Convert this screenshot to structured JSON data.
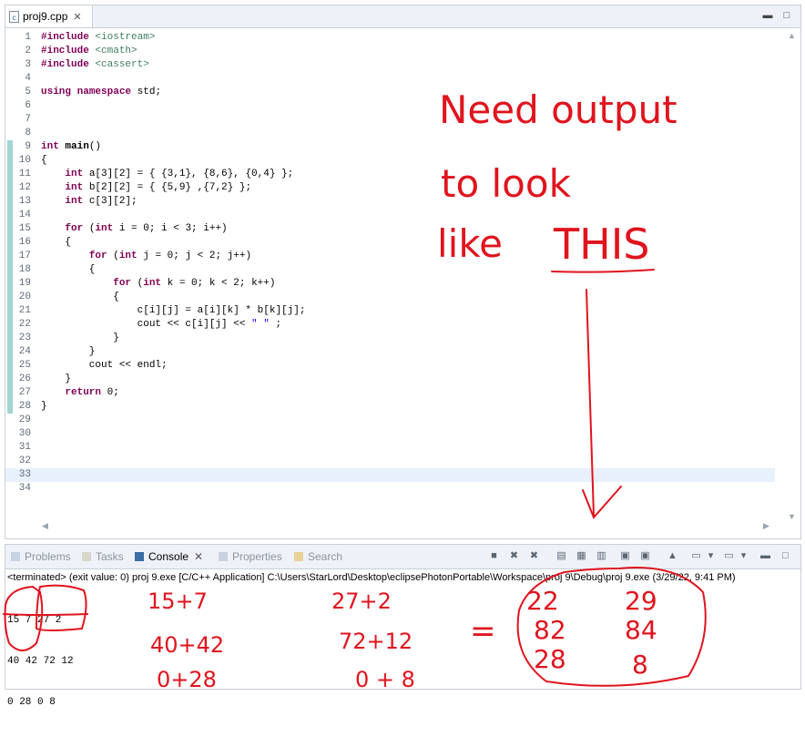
{
  "editor": {
    "tab_label": "proj9.cpp",
    "tab_icon": "c-file-icon",
    "lines": [
      {
        "n": "1",
        "html": "<span class='kw'>#include</span> <span class='inc'>&lt;iostream&gt;</span>"
      },
      {
        "n": "2",
        "html": "<span class='kw'>#include</span> <span class='inc'>&lt;cmath&gt;</span>"
      },
      {
        "n": "3",
        "html": "<span class='kw'>#include</span> <span class='inc'>&lt;cassert&gt;</span>"
      },
      {
        "n": "4",
        "html": ""
      },
      {
        "n": "5",
        "html": "<span class='kw'>using</span> <span class='kw'>namespace</span> std;"
      },
      {
        "n": "6",
        "html": ""
      },
      {
        "n": "7",
        "html": ""
      },
      {
        "n": "8",
        "html": ""
      },
      {
        "n": "9",
        "html": "<span class='kw'>int</span> <b>main</b>()"
      },
      {
        "n": "10",
        "html": "{"
      },
      {
        "n": "11",
        "html": "    <span class='kw'>int</span> a[3][2] = { {3,1}, {8,6}, {0,4} };"
      },
      {
        "n": "12",
        "html": "    <span class='kw'>int</span> b[2][2] = { {5,9} ,{7,2} };"
      },
      {
        "n": "13",
        "html": "    <span class='kw'>int</span> c[3][2];"
      },
      {
        "n": "14",
        "html": ""
      },
      {
        "n": "15",
        "html": "    <span class='kw'>for</span> (<span class='kw'>int</span> i = 0; i &lt; 3; i++)"
      },
      {
        "n": "16",
        "html": "    {"
      },
      {
        "n": "17",
        "html": "        <span class='kw'>for</span> (<span class='kw'>int</span> j = 0; j &lt; 2; j++)"
      },
      {
        "n": "18",
        "html": "        {"
      },
      {
        "n": "19",
        "html": "            <span class='kw'>for</span> (<span class='kw'>int</span> k = 0; k &lt; 2; k++)"
      },
      {
        "n": "20",
        "html": "            {"
      },
      {
        "n": "21",
        "html": "                c[i][j] = a[i][k] * b[k][j];"
      },
      {
        "n": "22",
        "html": "                cout &lt;&lt; c[i][j] &lt;&lt; <span class='str'>\" \"</span> ;"
      },
      {
        "n": "23",
        "html": "            }"
      },
      {
        "n": "24",
        "html": "        }"
      },
      {
        "n": "25",
        "html": "        cout &lt;&lt; endl;"
      },
      {
        "n": "26",
        "html": "    }"
      },
      {
        "n": "27",
        "html": "    <span class='kw'>return</span> 0;"
      },
      {
        "n": "28",
        "html": "}"
      },
      {
        "n": "29",
        "html": ""
      },
      {
        "n": "30",
        "html": ""
      },
      {
        "n": "31",
        "html": ""
      },
      {
        "n": "32",
        "html": ""
      },
      {
        "n": "33",
        "html": ""
      },
      {
        "n": "34",
        "html": ""
      }
    ]
  },
  "views": {
    "tabs": [
      {
        "label": "Problems",
        "icon": "problems-icon"
      },
      {
        "label": "Tasks",
        "icon": "tasks-icon"
      },
      {
        "label": "Console",
        "icon": "console-icon"
      },
      {
        "label": "Properties",
        "icon": "properties-icon"
      },
      {
        "label": "Search",
        "icon": "search-icon"
      }
    ],
    "active_tab": "Console"
  },
  "console": {
    "header": "<terminated> (exit value: 0) proj 9.exe [C/C++ Application] C:\\Users\\StarLord\\Desktop\\eclipsePhotonPortable\\Workspace\\proj 9\\Debug\\proj 9.exe (3/29/22, 9:41 PM)",
    "output": [
      "15 7 27 2",
      "40 42 72 12",
      "0 28 0 8"
    ]
  },
  "annotation": {
    "note_line1": "Need output",
    "note_line2": "to look",
    "note_line3": "like",
    "note_emph": "THIS",
    "sums_col1": [
      "15+7",
      "40+42",
      "0+28"
    ],
    "sums_col2": [
      "27+2",
      "72+12",
      "0 + 8"
    ],
    "equals": "=",
    "result": [
      [
        "22",
        "29"
      ],
      [
        "82",
        "84"
      ],
      [
        "28",
        "8"
      ]
    ],
    "ink_color": "#e0141e"
  }
}
